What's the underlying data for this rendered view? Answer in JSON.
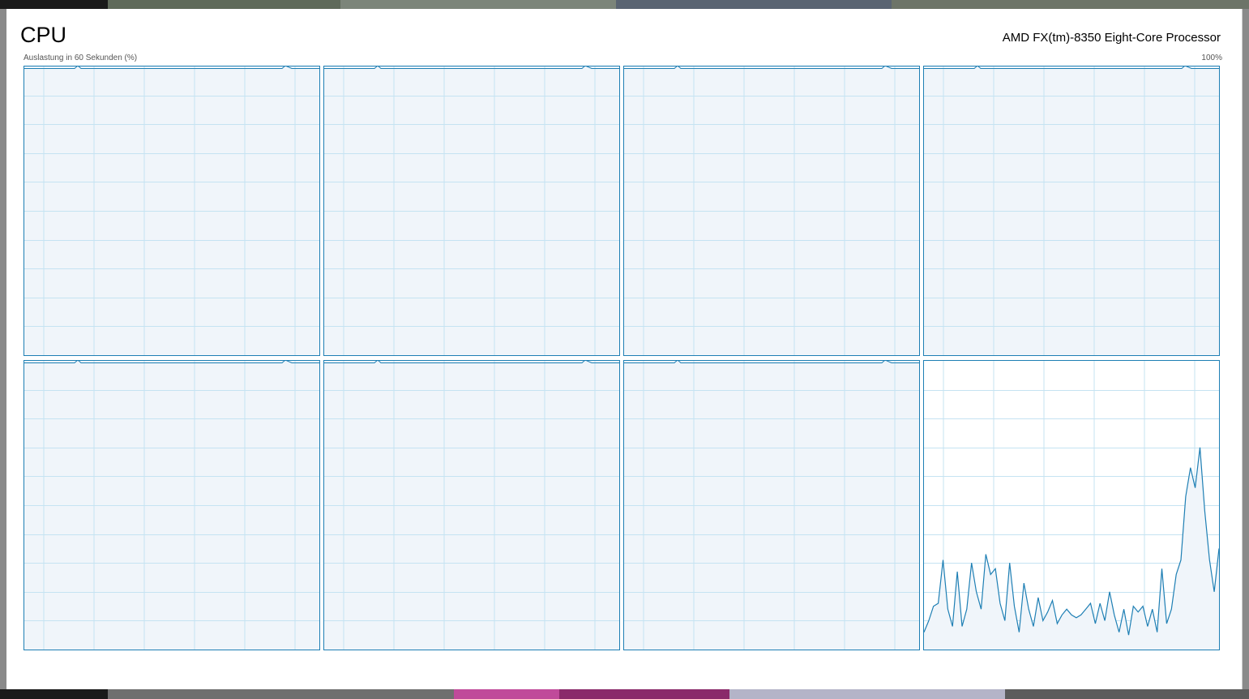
{
  "header": {
    "title": "CPU",
    "processor_name": "AMD FX(tm)-8350 Eight-Core Processor"
  },
  "graph": {
    "caption": "Auslastung in 60 Sekunden (%)",
    "max_label": "100%"
  },
  "colors": {
    "accent": "#1e7fb4",
    "grid": "#c5e3f2",
    "active_fill": "#f0f5fa",
    "window_bg": "#ffffff"
  },
  "cores": [
    {
      "index": 0,
      "active": false,
      "values": []
    },
    {
      "index": 1,
      "active": false,
      "values": []
    },
    {
      "index": 2,
      "active": false,
      "values": []
    },
    {
      "index": 3,
      "active": false,
      "values": []
    },
    {
      "index": 4,
      "active": false,
      "values": []
    },
    {
      "index": 5,
      "active": false,
      "values": []
    },
    {
      "index": 6,
      "active": false,
      "values": []
    },
    {
      "index": 7,
      "active": true,
      "values": [
        6,
        10,
        15,
        16,
        31,
        14,
        8,
        27,
        8,
        14,
        30,
        20,
        14,
        33,
        26,
        28,
        16,
        10,
        30,
        15,
        6,
        23,
        14,
        8,
        18,
        10,
        13,
        17,
        9,
        12,
        14,
        12,
        11,
        12,
        14,
        16,
        9,
        16,
        10,
        20,
        12,
        6,
        14,
        5,
        15,
        13,
        15,
        8,
        14,
        6,
        28,
        9,
        14,
        26,
        31,
        53,
        63,
        56,
        70,
        48,
        31,
        20,
        35
      ]
    }
  ]
}
